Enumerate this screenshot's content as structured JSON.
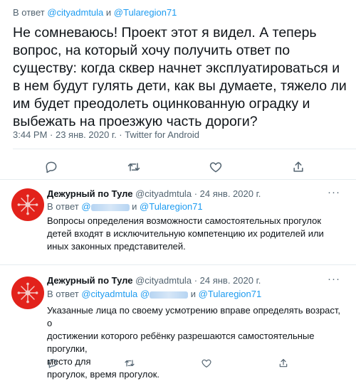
{
  "main": {
    "reply_prefix": "В ответ",
    "mention1": "@cityadmtula",
    "conj": "и",
    "mention2": "@Tularegion71",
    "text": "Не сомневаюсь! Проект этот я видел. А теперь вопрос, на который хочу получить ответ по существу: когда сквер начнет эксплуатироваться и в нем будут гулять дети, как вы думаете, тяжело ли им будет преодолеть оцинкованную оградку и выбежать на проезжую часть дороги?",
    "meta": "3:44 PM · 23 янв. 2020 г. · Twitter for Android",
    "action_icons": [
      "reply-icon",
      "retweet-icon",
      "like-icon",
      "share-icon"
    ]
  },
  "replies": [
    {
      "name": "Дежурный по Туле",
      "handle": "@cityadmtula",
      "date": "· 24 янв. 2020 г.",
      "more": "···",
      "reply_prefix": "В ответ",
      "mention_partial": "@",
      "partial_tail": "и",
      "mention": "@Tularegion71",
      "text": "Вопросы определения возможности самостоятельных прогулок детей входят в исключительную компетенцию их родителей или иных законных представителей."
    },
    {
      "name": "Дежурный по Туле",
      "handle": "@cityadmtula",
      "date": "· 24 янв. 2020 г.",
      "more": "···",
      "reply_prefix": "В ответ",
      "mention1": "@cityadmtula",
      "mention_partial": "@",
      "conj": "и",
      "mention2": "@Tularegion71",
      "text_line1": "Указанные лица по своему усмотрению вправе определять возраст, о",
      "text_line2": "достижении которого ребёнку разрешаются самостоятельные прогулки,",
      "text_line3": "место для",
      "text_line4": "прогулок, время прогулок."
    }
  ],
  "colors": {
    "link": "#1d9bf0",
    "muted": "#536471",
    "avatar": "#e2221b",
    "divider": "#e6ecf0"
  }
}
